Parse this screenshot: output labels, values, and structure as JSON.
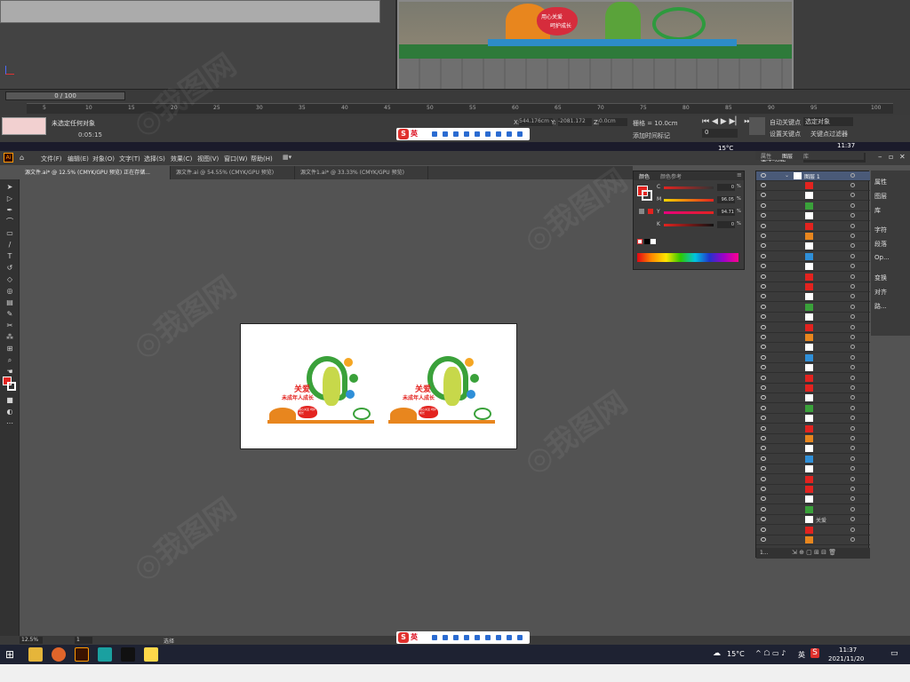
{
  "max": {
    "frame_counter": "0 / 100",
    "ruler_ticks": [
      "5",
      "10",
      "15",
      "20",
      "25",
      "30",
      "35",
      "40",
      "45",
      "50",
      "55",
      "60",
      "65",
      "70",
      "75",
      "80",
      "85",
      "90",
      "95",
      "100"
    ],
    "status_text": "未选定任何对象",
    "time_readout": "0:05:15",
    "coord_x_label": "X:",
    "coord_x": "544.176cm",
    "coord_y_label": "Y:",
    "coord_y": "-2081.172",
    "coord_z_label": "Z:",
    "coord_z": "0.0cm",
    "grid_label": "栅格 = 10.0cm",
    "add_marker": "添加时间标记",
    "auto_key": "自动关键点",
    "set_key": "设置关键点",
    "selected_object": "选定对象",
    "key_filters": "关键点过滤器",
    "frame_value": "0",
    "render_sign_line1": "用心关爱",
    "render_sign_line2": "呵护成长"
  },
  "taskbar_top": {
    "temperature": "15°C",
    "time": "11:37"
  },
  "ai": {
    "logo": "Ai",
    "menus": [
      "文件(F)",
      "编辑(E)",
      "对象(O)",
      "文字(T)",
      "选择(S)",
      "效果(C)",
      "视图(V)",
      "窗口(W)",
      "帮助(H)"
    ],
    "workspace": "基本功能",
    "search_placeholder": "搜索 Adobe Stock",
    "tabs": [
      "源文件.ai* @ 12.5% (CMYK/GPU 预览) 正在存储...",
      "源文件.ai @ 54.55% (CMYK/GPU 预览)",
      "源文件1.ai* @ 33.33% (CMYK/GPU 预览)"
    ],
    "zoom": "12.5%",
    "artboard_num": "1",
    "status_tool": "选择",
    "artwork": {
      "title1": "关爱",
      "title2": "未成年人成长",
      "badge": "用心关爱 呵护成长"
    }
  },
  "color_panel": {
    "tab1": "颜色",
    "tab2": "颜色参考",
    "channels": [
      {
        "label": "C",
        "value": "0",
        "unit": "%",
        "color": "#2fb8d8"
      },
      {
        "label": "M",
        "value": "96.05",
        "unit": "%",
        "color": "#e6007e"
      },
      {
        "label": "Y",
        "value": "94.71",
        "unit": "%",
        "color": "#f5d300"
      },
      {
        "label": "K",
        "value": "0",
        "unit": "%",
        "color": "#222222"
      }
    ],
    "fill_color": "#e3231f"
  },
  "layers_panel": {
    "tabs": [
      "属性",
      "图层",
      "库"
    ],
    "layer_name": "图层 1",
    "item_label": "关爱",
    "footer_count": "1..."
  },
  "props_dock": {
    "items": [
      "属性",
      "图层",
      "库",
      "字符",
      "段落",
      "Op...",
      "变换",
      "对齐",
      "路..."
    ]
  },
  "ime": {
    "label": "英"
  },
  "taskbar_bottom": {
    "temperature": "15°C",
    "lang": "英",
    "time": "11:37",
    "date": "2021/11/20"
  }
}
